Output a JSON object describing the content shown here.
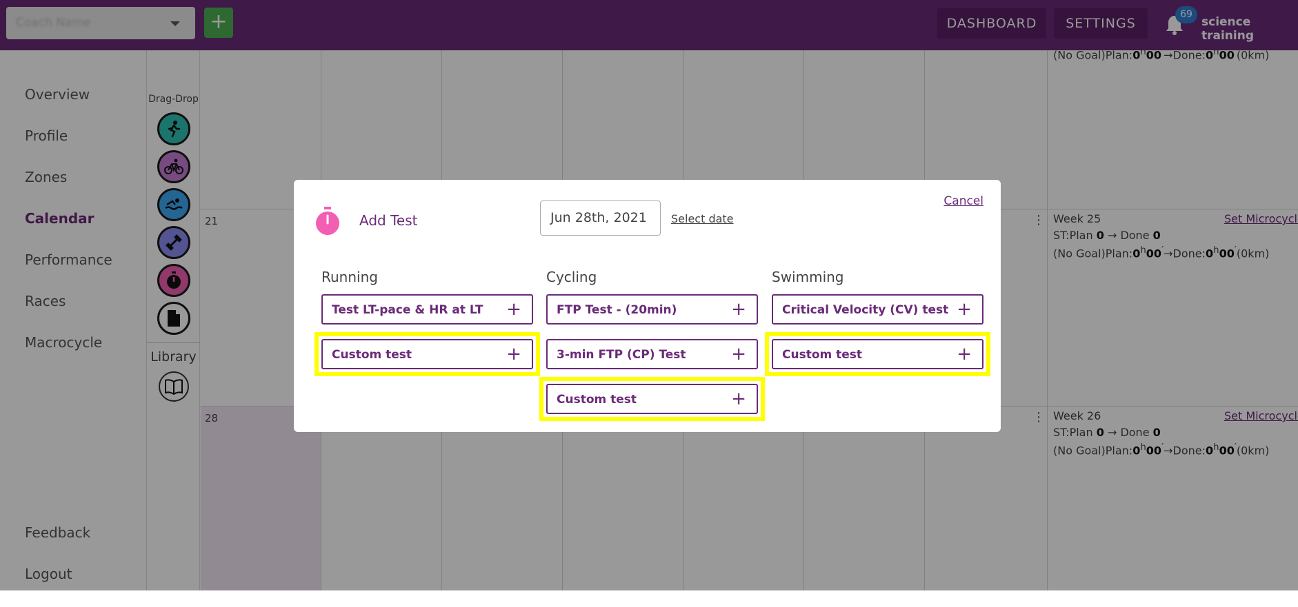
{
  "topbar": {
    "coach_select_value": "Coach Name",
    "add_button": "+",
    "dashboard": "DASHBOARD",
    "settings": "SETTINGS",
    "notifications": "69",
    "user": "science training"
  },
  "sidebar": {
    "items": [
      "Overview",
      "Profile",
      "Zones",
      "Calendar",
      "Performance",
      "Races",
      "Macrocycle"
    ],
    "bottom_items": [
      "Feedback",
      "Logout"
    ],
    "active": "Calendar"
  },
  "toolbox": {
    "drag_label": "Drag-Drop",
    "sports": [
      {
        "name": "running",
        "color": "#2ec4b6"
      },
      {
        "name": "cycling",
        "color": "#c77dd6"
      },
      {
        "name": "swimming",
        "color": "#3fa9f5"
      },
      {
        "name": "strength",
        "color": "#8e8df5"
      },
      {
        "name": "test",
        "color": "#f25fb3"
      },
      {
        "name": "document",
        "color": "#ffffff"
      }
    ],
    "library_label": "Library"
  },
  "calendar": {
    "day_numbers": [
      "21",
      "28"
    ],
    "weeks": [
      {
        "plan_line": "(No Goal)Plan:",
        "plan_h": "0",
        "plan_m": "00",
        "done_h": "0",
        "done_m": "00",
        "km": "(0km)"
      },
      {
        "title": "Week 25",
        "link": "Set Microcycle",
        "st_plan": "0",
        "st_done": "0",
        "plan_line": "(No Goal)Plan:",
        "plan_h": "0",
        "plan_m": "00",
        "done_h": "0",
        "done_m": "00",
        "km": "(0km)"
      },
      {
        "title": "Week 26",
        "link": "Set Microcycle",
        "st_plan": "0",
        "st_done": "0",
        "plan_line": "(No Goal)Plan:",
        "plan_h": "0",
        "plan_m": "00",
        "done_h": "0",
        "done_m": "00",
        "km": "(0km)"
      }
    ],
    "st_plan_label": "ST:Plan",
    "done_label": "Done",
    "arrow": "→",
    "hour_unit": "h",
    "min_unit": "′"
  },
  "modal": {
    "title": "Add Test",
    "date": "Jun 28th, 2021",
    "select_date": "Select date",
    "cancel": "Cancel",
    "columns": [
      {
        "heading": "Running",
        "tests": [
          "Test LT-pace & HR at LT",
          "Custom test"
        ]
      },
      {
        "heading": "Cycling",
        "tests": [
          "FTP Test - (20min)",
          "3-min FTP (CP) Test",
          "Custom test"
        ]
      },
      {
        "heading": "Swimming",
        "tests": [
          "Critical Velocity (CV) test",
          "Custom test"
        ]
      }
    ],
    "plus": "+"
  },
  "colors": {
    "brand": "#6a2a78",
    "highlight": "#ffff00",
    "pink": "#f25fb3"
  }
}
